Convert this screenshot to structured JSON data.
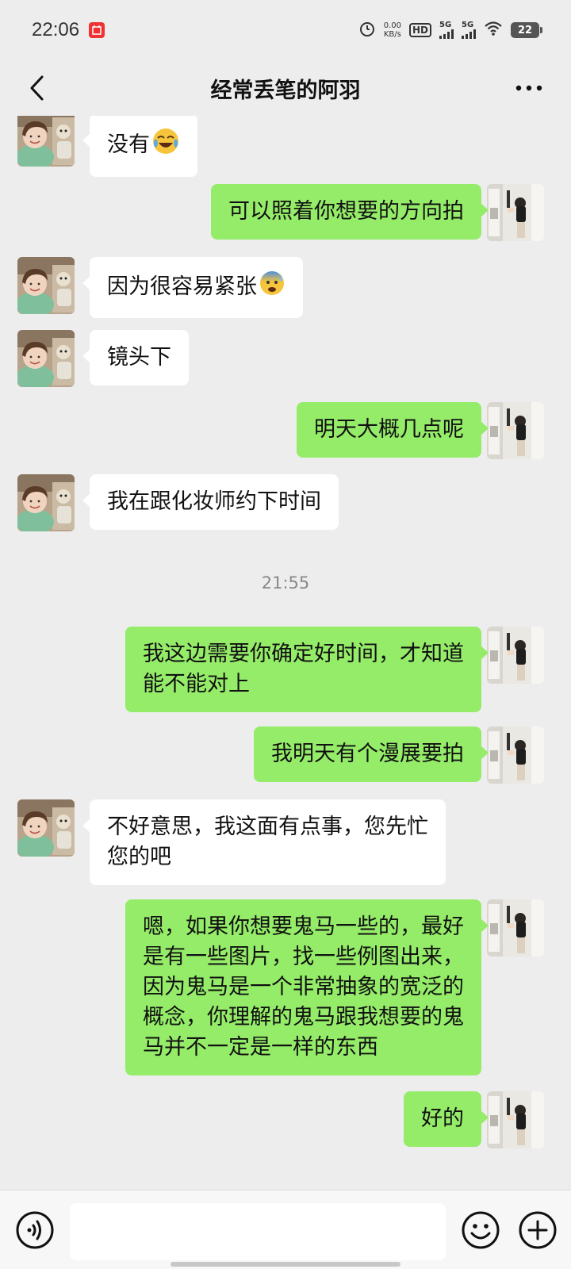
{
  "status_bar": {
    "time": "22:06",
    "net_speed_value": "0.00",
    "net_speed_unit": "KB/s",
    "hd_label": "HD",
    "sim1_label": "5G",
    "sim2_label": "5G",
    "battery": "22"
  },
  "header": {
    "title": "经常丢笔的阿羽"
  },
  "messages": [
    {
      "side": "left",
      "text": "没有",
      "emoji": "face-with-tears-of-joy-icon"
    },
    {
      "side": "right",
      "text": "可以照着你想要的方向拍"
    },
    {
      "side": "left",
      "text": "因为很容易紧张",
      "emoji": "anxious-face-with-sweat-icon"
    },
    {
      "side": "left",
      "text": "镜头下"
    },
    {
      "side": "right",
      "text": "明天大概几点呢"
    },
    {
      "side": "left",
      "text": "我在跟化妆师约下时间"
    },
    {
      "type": "timestamp",
      "text": "21:55"
    },
    {
      "side": "right",
      "line1": "我这边需要你确定好时间，才知道",
      "line2": "能不能对上"
    },
    {
      "side": "right",
      "text": "我明天有个漫展要拍"
    },
    {
      "side": "left",
      "line1": "不好意思，我这面有点事，您先忙",
      "line2": "您的吧"
    },
    {
      "side": "right",
      "line1": "嗯，如果你想要鬼马一些的，最好",
      "line2": "是有一些图片，找一些例图出来，",
      "line3": "因为鬼马是一个非常抽象的宽泛的",
      "line4": "概念，你理解的鬼马跟我想要的鬼",
      "line5": "马并不一定是一样的东西"
    },
    {
      "side": "right",
      "text": "好的"
    }
  ],
  "bottom_bar": {
    "input_value": ""
  },
  "colors": {
    "background": "#ededed",
    "bubble_sent": "#95ec69",
    "bubble_received": "#ffffff"
  }
}
